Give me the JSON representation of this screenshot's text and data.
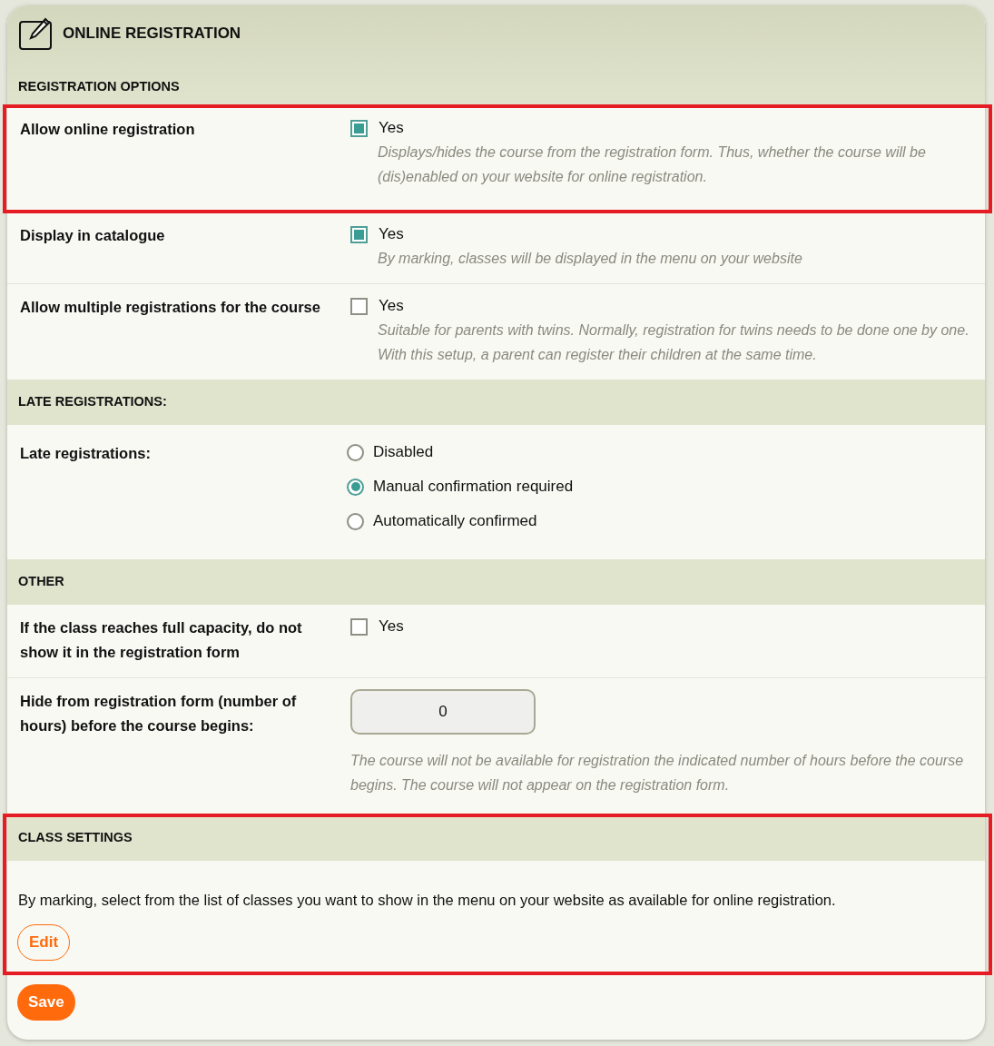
{
  "panel": {
    "title": "ONLINE REGISTRATION"
  },
  "sections": [
    {
      "title": "REGISTRATION OPTIONS",
      "highlighted": false,
      "rows": [
        {
          "label": "Allow online registration",
          "highlighted": true,
          "control": {
            "kind": "checkbox",
            "label": "Yes",
            "checked": true
          },
          "description": "Displays/hides the course from the registration form. Thus, whether the course will be (dis)enabled on your website for online registration."
        },
        {
          "label": "Display in catalogue",
          "highlighted": false,
          "control": {
            "kind": "checkbox",
            "label": "Yes",
            "checked": true
          },
          "description": "By marking, classes will be displayed in the menu on your website"
        },
        {
          "label": "Allow multiple registrations for the course",
          "highlighted": false,
          "control": {
            "kind": "checkbox",
            "label": "Yes",
            "checked": false
          },
          "description": "Suitable for parents with twins. Normally, registration for twins needs to be done one by one. With this setup, a parent can register their children at the same time."
        }
      ]
    },
    {
      "title": "LATE REGISTRATIONS:",
      "highlighted": false,
      "rows": [
        {
          "label": "Late registrations:",
          "highlighted": false,
          "control": {
            "kind": "radio",
            "options": [
              {
                "label": "Disabled",
                "selected": false
              },
              {
                "label": "Manual confirmation required",
                "selected": true
              },
              {
                "label": "Automatically confirmed",
                "selected": false
              }
            ]
          }
        }
      ]
    },
    {
      "title": "OTHER",
      "highlighted": false,
      "rows": [
        {
          "label": "If the class reaches full capacity, do not show it in the registration form",
          "highlighted": false,
          "control": {
            "kind": "checkbox",
            "label": "Yes",
            "checked": false
          }
        },
        {
          "label": "Hide from registration form (number of hours) before the course begins:",
          "highlighted": false,
          "control": {
            "kind": "number",
            "value": "0"
          },
          "description": "The course will not be available for registration the indicated number of hours before the course begins. The course will not appear on the registration form."
        }
      ]
    },
    {
      "title": "CLASS SETTINGS",
      "highlighted": true,
      "text": "By marking, select from the list of classes you want to show in the menu on your website as available for online registration.",
      "button": "Edit"
    }
  ],
  "save_button": "Save"
}
